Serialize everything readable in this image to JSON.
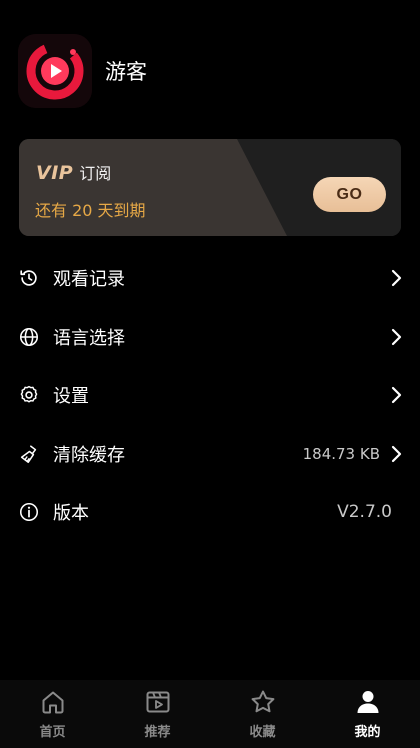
{
  "profile": {
    "username": "游客"
  },
  "vip": {
    "badge": "VIP",
    "title": "订阅",
    "days_left": "还有 20 天到期",
    "go_label": "GO"
  },
  "menu": {
    "items": [
      {
        "icon": "history-clock-icon",
        "label": "观看记录",
        "value": ""
      },
      {
        "icon": "globe-icon",
        "label": "语言选择",
        "value": ""
      },
      {
        "icon": "gear-icon",
        "label": "设置",
        "value": ""
      },
      {
        "icon": "broom-icon",
        "label": "清除缓存",
        "value": "184.73 KB"
      },
      {
        "icon": "info-icon",
        "label": "版本",
        "value": "V2.7.0"
      }
    ]
  },
  "tabbar": {
    "tabs": [
      {
        "icon": "home-icon",
        "label": "首页",
        "active": false
      },
      {
        "icon": "film-icon",
        "label": "推荐",
        "active": false
      },
      {
        "icon": "star-icon",
        "label": "收藏",
        "active": false
      },
      {
        "icon": "user-icon",
        "label": "我的",
        "active": true
      }
    ]
  },
  "colors": {
    "background": "#000000",
    "vip_gold": "#e9c49c",
    "days_orange": "#e6a846",
    "go_button": "#f0cda9",
    "logo_red": "#e8193c"
  }
}
